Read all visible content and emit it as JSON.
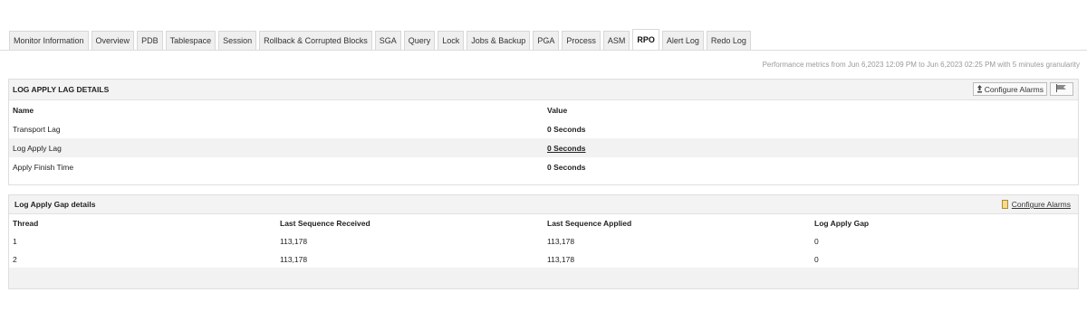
{
  "tabs": [
    {
      "label": "Monitor Information",
      "active": false
    },
    {
      "label": "Overview",
      "active": false
    },
    {
      "label": "PDB",
      "active": false
    },
    {
      "label": "Tablespace",
      "active": false
    },
    {
      "label": "Session",
      "active": false
    },
    {
      "label": "Rollback & Corrupted Blocks",
      "active": false
    },
    {
      "label": "SGA",
      "active": false
    },
    {
      "label": "Query",
      "active": false
    },
    {
      "label": "Lock",
      "active": false
    },
    {
      "label": "Jobs & Backup",
      "active": false
    },
    {
      "label": "PGA",
      "active": false
    },
    {
      "label": "Process",
      "active": false
    },
    {
      "label": "ASM",
      "active": false
    },
    {
      "label": "RPO",
      "active": true
    },
    {
      "label": "Alert Log",
      "active": false
    },
    {
      "label": "Redo Log",
      "active": false
    }
  ],
  "perf_note": "Performance metrics from Jun 6,2023 12:09 PM to Jun 6,2023 02:25 PM with 5 minutes granularity",
  "lag_panel": {
    "title": "LOG APPLY LAG DETAILS",
    "configure_label": "Configure Alarms",
    "configure_icon": "alarm-icon",
    "flag_icon": "flag-icon",
    "headers": {
      "name": "Name",
      "value": "Value"
    },
    "rows": [
      {
        "name": "Transport Lag",
        "value": "0 Seconds"
      },
      {
        "name": "Log Apply Lag",
        "value": "0 Seconds"
      },
      {
        "name": "Apply Finish Time",
        "value": "0 Seconds"
      }
    ]
  },
  "gap_panel": {
    "title": "Log Apply Gap details",
    "configure_label": "Configure Alarms",
    "configure_icon": "alarm-icon",
    "headers": {
      "thread": "Thread",
      "received": "Last Sequence Received",
      "applied": "Last Sequence Applied",
      "gap": "Log Apply Gap"
    },
    "rows": [
      {
        "thread": "1",
        "received": "113,178",
        "applied": "113,178",
        "gap": "0"
      },
      {
        "thread": "2",
        "received": "113,178",
        "applied": "113,178",
        "gap": "0"
      }
    ]
  }
}
